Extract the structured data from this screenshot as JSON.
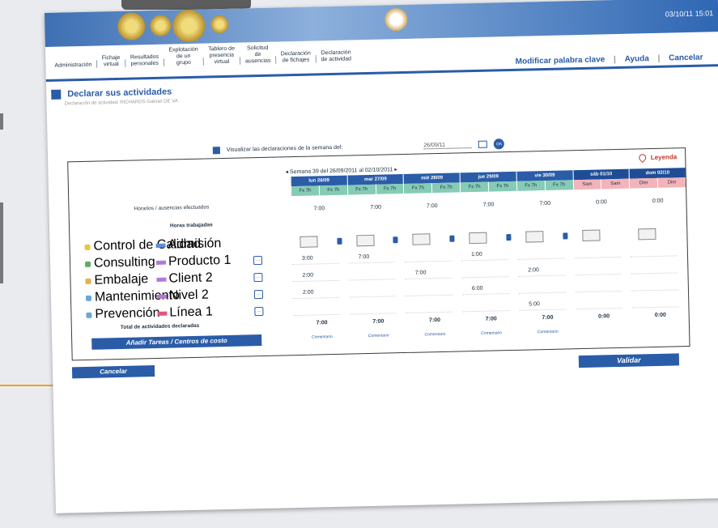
{
  "app": {
    "datetime": "03/10/11 15:01"
  },
  "nav": {
    "items": [
      "Administración",
      "Fichaje\nvirtual",
      "Resultados\npersonales",
      "Explotación\nde un\ngrupo",
      "Tablero de\npresencia\nvirtual",
      "Solicitud\nde\nausencias",
      "Declaración\nde fichajes",
      "Declaración\nde actividad"
    ]
  },
  "top_links": {
    "modify": "Modificar palabra clave",
    "help": "Ayuda",
    "cancel": "Cancelar"
  },
  "page": {
    "title": "Declarar sus actividades",
    "breadcrumb": "Declaración de actividad: RICHARDS Gabriel DE VA"
  },
  "week_selector": {
    "label": "Visualizar las declaraciones de la semana del:",
    "date": "26/09/11",
    "ok": "OK"
  },
  "legend": {
    "label": "Leyenda"
  },
  "week": {
    "label": "Semana 39 del 26/09/2011 al 02/10/2011"
  },
  "days": [
    {
      "name": "lun 26/09",
      "shifts": [
        "Fx 7h",
        "Fx 7h"
      ],
      "worked": "7:00",
      "total": "7:00",
      "comment": "Comentario",
      "weekend": false
    },
    {
      "name": "mar 27/09",
      "shifts": [
        "Fx 7h",
        "Fx 7h"
      ],
      "worked": "7:00",
      "total": "7:00",
      "comment": "Comentario",
      "weekend": false
    },
    {
      "name": "mié 28/09",
      "shifts": [
        "Fx 7h",
        "Fx 7h"
      ],
      "worked": "7:00",
      "total": "7:00",
      "comment": "Comentario",
      "weekend": false
    },
    {
      "name": "jue 29/09",
      "shifts": [
        "Fx 7h",
        "Fx 7h"
      ],
      "worked": "7:00",
      "total": "7:00",
      "comment": "Comentario",
      "weekend": false
    },
    {
      "name": "vie 30/09",
      "shifts": [
        "Fx 7h",
        "Fx 7h"
      ],
      "worked": "7:00",
      "total": "7:00",
      "comment": "Comentario",
      "weekend": false
    },
    {
      "name": "sáb 01/10",
      "shifts": [
        "Sam",
        "Sam"
      ],
      "worked": "0:00",
      "total": "0:00",
      "comment": "",
      "weekend": true
    },
    {
      "name": "dom 02/10",
      "shifts": [
        "Dim",
        "Dim"
      ],
      "worked": "0:00",
      "total": "0:00",
      "comment": "",
      "weekend": true
    }
  ],
  "labels": {
    "schedule": "Horarios / ausencias efectuados",
    "worked": "Horas trabajadas",
    "total": "Total de actividades declaradas"
  },
  "activities": [
    {
      "project": "Control de Calidad",
      "task": "Admisión",
      "project_color": "#e8c53c",
      "task_color": "#5b8fd6",
      "values": [
        "",
        "",
        "",
        "",
        "",
        "",
        ""
      ],
      "inputs": true
    },
    {
      "project": "Consulting",
      "task": "Producto 1",
      "project_color": "#5fae5f",
      "task_color": "#b07ad8",
      "values": [
        "3:00",
        "7:00",
        "",
        "1:00",
        "",
        "",
        ""
      ],
      "inputs": false
    },
    {
      "project": "Embalaje",
      "task": "Client 2",
      "project_color": "#e3b34a",
      "task_color": "#b07ad8",
      "values": [
        "2:00",
        "",
        "7:00",
        "",
        "2:00",
        "",
        ""
      ],
      "inputs": false
    },
    {
      "project": "Mantenimiento",
      "task": "Nivel 2",
      "project_color": "#6aa8d8",
      "task_color": "#b07ad8",
      "values": [
        "2:00",
        "",
        "",
        "6:00",
        "",
        "",
        ""
      ],
      "inputs": false
    },
    {
      "project": "Prevención",
      "task": "Línea 1",
      "project_color": "#6aa8d8",
      "task_color": "#e0587a",
      "values": [
        "",
        "",
        "",
        "",
        "5:00",
        "",
        ""
      ],
      "inputs": false
    }
  ],
  "buttons": {
    "add": "Añadir Tareas / Centros de costo",
    "cancel": "Cancelar",
    "validate": "Validar"
  }
}
